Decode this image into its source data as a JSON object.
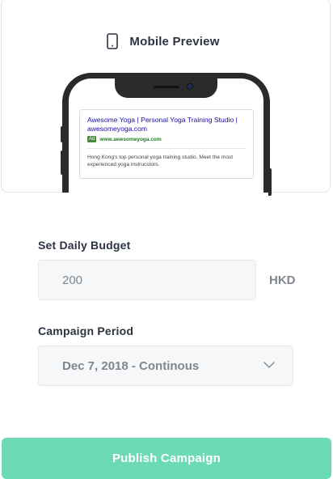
{
  "preview": {
    "title": "Mobile Preview",
    "icon": "mobile-phone-icon",
    "ad": {
      "headline": "Awesome Yoga | Personal Yoga Training Studio | awesomeyoga.com",
      "badge": "Ad",
      "display_url": "www.awesomeyoga.com",
      "description": "Hong Kong's top personal yoga training studio. Meet the most experienced yoga instrucstors."
    }
  },
  "budget": {
    "label": "Set Daily Budget",
    "value": "200",
    "currency": "HKD"
  },
  "period": {
    "label": "Campaign Period",
    "value": "Dec 7, 2018 - Continous",
    "icon": "chevron-down-icon"
  },
  "actions": {
    "publish_label": "Publish Campaign"
  },
  "colors": {
    "accent": "#6cdbb3",
    "text_dark": "#2c3340",
    "text_muted": "#80868f",
    "field_bg": "#f6f7f9"
  }
}
